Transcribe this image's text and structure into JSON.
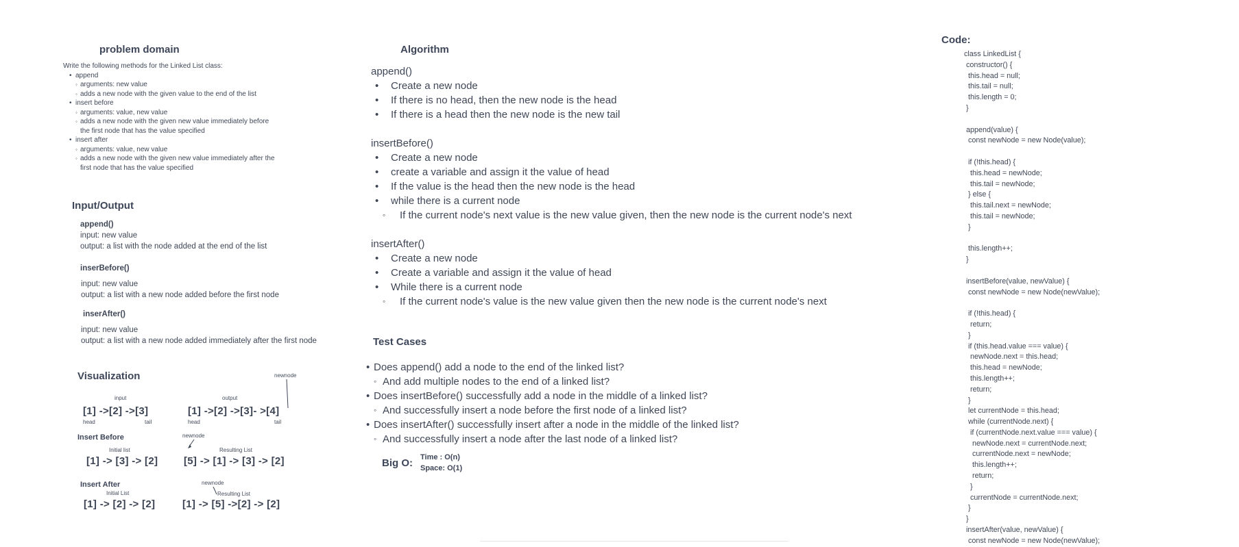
{
  "problem_domain": {
    "title": "problem domain",
    "intro": "Write the following methods for the Linked List class:",
    "methods": [
      {
        "name": "append",
        "details": [
          "arguments: new value",
          "adds a new node with the given value to the end of the list"
        ]
      },
      {
        "name": "insert before",
        "details": [
          "arguments: value, new value",
          "adds a new node with the given new value immediately before",
          "the first node that has the value specified"
        ]
      },
      {
        "name": "insert after",
        "details": [
          "arguments: value, new value",
          "adds a new node with the given new value immediately after the",
          "first node that has the value specified"
        ]
      }
    ]
  },
  "io": {
    "title": "Input/Output",
    "append": {
      "name": "append()",
      "input": "input: new value",
      "output": "output: a list with the node added at the end of the list"
    },
    "insert_before": {
      "name": "inserBefore()",
      "input": "input: new value",
      "output": "output: a list with a new node added before the first node"
    },
    "insert_after": {
      "name": "inserAfter()",
      "input": "input: new value",
      "output": "output: a list with a new node added immediately after the first node"
    }
  },
  "viz": {
    "title": "Visualization",
    "append": {
      "input_label": "input",
      "output_label": "output",
      "newnode_label": "newnode",
      "input_list": "[1] ->[2] ->[3]",
      "output_list": "[1] ->[2] ->[3]- >[4]",
      "head": "head",
      "tail": "tail"
    },
    "insert_before": {
      "title": "Insert Before",
      "newnode_label": "newnode",
      "initial_label": "Initial list",
      "initial_list": "[1] -> [3] -> [2]",
      "result_label": "Resulting List",
      "result_list": "[5] -> [1] -> [3] -> [2]"
    },
    "insert_after": {
      "title": "Insert After",
      "newnode_label": "newnode",
      "initial_label": "Initial List",
      "initial_list": "[1] -> [2] -> [2]",
      "result_label": "Resulting List",
      "result_list": "[1] -> [5] ->[2]  -> [2]"
    }
  },
  "algorithm": {
    "title": "Algorithm",
    "sections": [
      {
        "heading": "append()",
        "items": [
          {
            "text": "Create a new node"
          },
          {
            "text": "If there is no head, then the new node is the head"
          },
          {
            "text": "If there is a head then the new node is the new tail"
          }
        ]
      },
      {
        "heading": "insertBefore()",
        "items": [
          {
            "text": "Create a new node"
          },
          {
            "text": "create a variable and assign it the value of head"
          },
          {
            "text": "If the value is the head then the new node is the head"
          },
          {
            "text": "while there is a current node"
          },
          {
            "text": "If the current node's next value is the new value given, then the new node is the current node's next",
            "sub": true
          }
        ]
      },
      {
        "heading": "insertAfter()",
        "items": [
          {
            "text": "Create a new node"
          },
          {
            "text": "Create a variable and assign it the value of head"
          },
          {
            "text": "While there is a current node"
          },
          {
            "text": "If the current node's value is the new value given then the new node is the current node's next",
            "sub": true
          }
        ]
      }
    ]
  },
  "tests": {
    "title": "Test Cases",
    "items": [
      {
        "text": "Does append() add a node to the end of the linked list?"
      },
      {
        "text": "And add multiple nodes to the end of a linked list?",
        "sub": true
      },
      {
        "text": "Does insertBefore() successfully add a node in the middle of a linked list?"
      },
      {
        "text": "And successfully insert a node before the first node of a linked list?",
        "sub": true
      },
      {
        "text": "Does insertAfter() successfully insert after a node in the middle of the linked list?"
      },
      {
        "text": "And successfully insert a node after the last node of a linked list?",
        "sub": true
      }
    ]
  },
  "big_o": {
    "label": "Big O:",
    "time": "Time : O(n)",
    "space": "Space: O(1)"
  },
  "code": {
    "title": "Code:",
    "lines": [
      "class LinkedList {",
      " constructor() {",
      "  this.head = null;",
      "  this.tail = null;",
      "  this.length = 0;",
      " }",
      "",
      " append(value) {",
      "  const newNode = new Node(value);",
      "",
      "  if (!this.head) {",
      "   this.head = newNode;",
      "   this.tail = newNode;",
      "  } else {",
      "   this.tail.next = newNode;",
      "   this.tail = newNode;",
      "  }",
      "",
      "  this.length++;",
      " }",
      "",
      " insertBefore(value, newValue) {",
      "  const newNode = new Node(newValue);",
      "",
      "  if (!this.head) {",
      "   return;",
      "  }",
      "  if (this.head.value === value) {",
      "   newNode.next = this.head;",
      "   this.head = newNode;",
      "   this.length++;",
      "   return;",
      "  }",
      "  let currentNode = this.head;",
      "  while (currentNode.next) {",
      "   if (currentNode.next.value === value) {",
      "    newNode.next = currentNode.next;",
      "    currentNode.next = newNode;",
      "    this.length++;",
      "    return;",
      "   }",
      "   currentNode = currentNode.next;",
      "  }",
      " }",
      " insertAfter(value, newValue) {",
      "  const newNode = new Node(newValue);"
    ]
  }
}
